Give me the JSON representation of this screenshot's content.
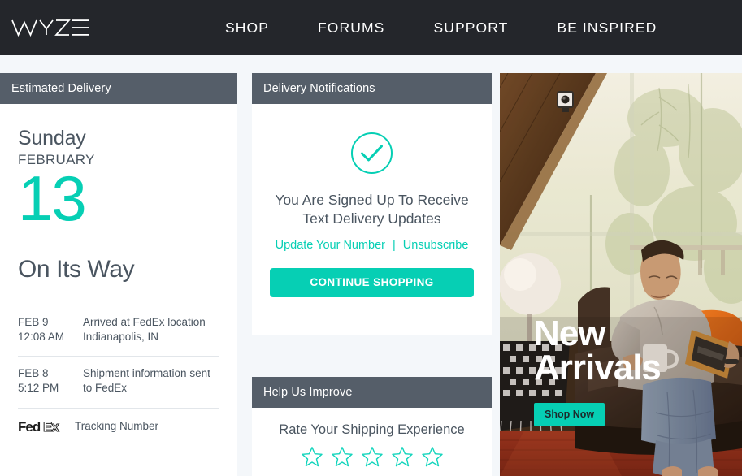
{
  "nav": {
    "brand": "WYZE",
    "items": [
      {
        "label": "SHOP"
      },
      {
        "label": "FORUMS"
      },
      {
        "label": "SUPPORT"
      },
      {
        "label": "BE INSPIRED"
      }
    ]
  },
  "colors": {
    "accent_teal": "#06CFB4",
    "panel_header": "#555E69",
    "nav_background": "#24262B",
    "text": "#4A5560",
    "page_background": "#F4F7FA"
  },
  "estimated_delivery": {
    "header": "Estimated Delivery",
    "weekday": "Sunday",
    "month": "FEBRUARY",
    "day": "13",
    "status": "On Its Way",
    "history": [
      {
        "date": "FEB 9",
        "time": "12:08 AM",
        "description_line1": "Arrived at FedEx location",
        "description_line2": "Indianapolis, IN"
      },
      {
        "date": "FEB 8",
        "time": "5:12 PM",
        "description_line1": "Shipment information sent",
        "description_line2": "to FedEx"
      }
    ],
    "carrier": {
      "logo_label": "FedEx",
      "tracking_label": "Tracking Number"
    }
  },
  "delivery_notifications": {
    "header": "Delivery Notifications",
    "status_icon": "check-circle-icon",
    "message_line1": "You Are Signed Up To Receive",
    "message_line2": "Text Delivery Updates",
    "update_link": "Update Your Number",
    "separator": "|",
    "unsubscribe_link": "Unsubscribe",
    "cta_label": "CONTINUE SHOPPING"
  },
  "help_us_improve": {
    "header": "Help Us Improve",
    "prompt": "Rate Your Shipping Experience",
    "stars_total": 5,
    "stars_selected": 0
  },
  "promo": {
    "title_line1": "New",
    "title_line2": "Arrivals",
    "button_label": "Shop Now"
  }
}
